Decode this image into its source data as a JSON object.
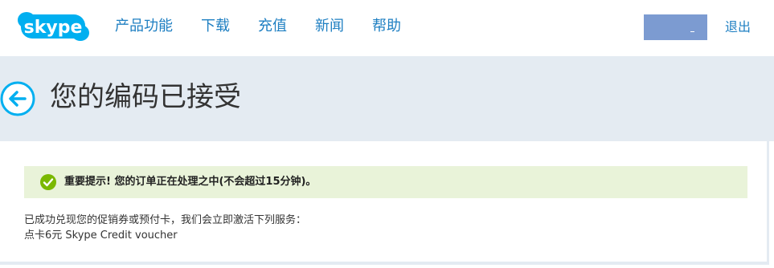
{
  "header": {
    "logo_text": "skype",
    "nav": [
      "产品功能",
      "下载",
      "充值",
      "新闻",
      "帮助"
    ],
    "logout": "退出"
  },
  "banner": {
    "title": "您的编码已接受"
  },
  "notice": {
    "text": "重要提示! 您的订单正在处理之中(不会超过15分钟)。"
  },
  "content": {
    "line1": "已成功兑现您的促销券或预付卡，我们会立即激活下列服务：",
    "line2": "点卡6元 Skype Credit voucher"
  },
  "colors": {
    "brand_blue": "#00aff0",
    "link_blue": "#1e7fc2",
    "banner_bg": "#e4ebf2",
    "notice_bg": "#e9f3d9",
    "check_green": "#7ab800"
  },
  "icons": {
    "back": "arrow-left-circle-icon",
    "check": "check-circle-icon"
  }
}
